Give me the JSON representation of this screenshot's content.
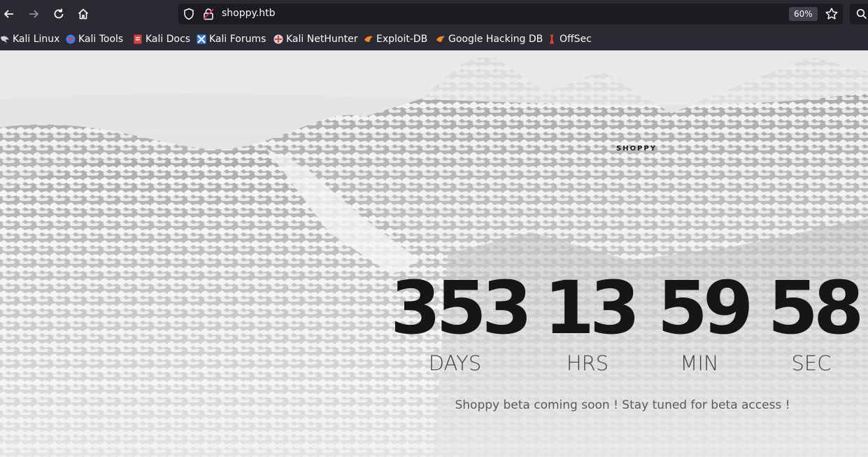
{
  "browser": {
    "url": "shoppy.htb",
    "zoom": "60%"
  },
  "bookmarks": [
    {
      "label": "Kali Linux",
      "icon": "kali-dragon-icon"
    },
    {
      "label": "Kali Tools",
      "icon": "kali-tools-icon"
    },
    {
      "label": "Kali Docs",
      "icon": "kali-docs-icon"
    },
    {
      "label": "Kali Forums",
      "icon": "kali-forums-icon"
    },
    {
      "label": "Kali NetHunter",
      "icon": "kali-nethunter-icon"
    },
    {
      "label": "Exploit-DB",
      "icon": "exploit-db-icon"
    },
    {
      "label": "Google Hacking DB",
      "icon": "ghdb-icon"
    },
    {
      "label": "OffSec",
      "icon": "offsec-icon"
    }
  ],
  "page": {
    "brand": "SHOPPY",
    "countdown": [
      {
        "value": "353",
        "unit": "DAYS"
      },
      {
        "value": "13",
        "unit": "HRS"
      },
      {
        "value": "59",
        "unit": "MIN"
      },
      {
        "value": "58",
        "unit": "SEC"
      }
    ],
    "tagline": "Shoppy beta coming soon ! Stay tuned for beta access !"
  },
  "colors": {
    "toolbar": "#2b2a33",
    "urlbar": "#1c1b22",
    "countdown_text": "#161616"
  }
}
